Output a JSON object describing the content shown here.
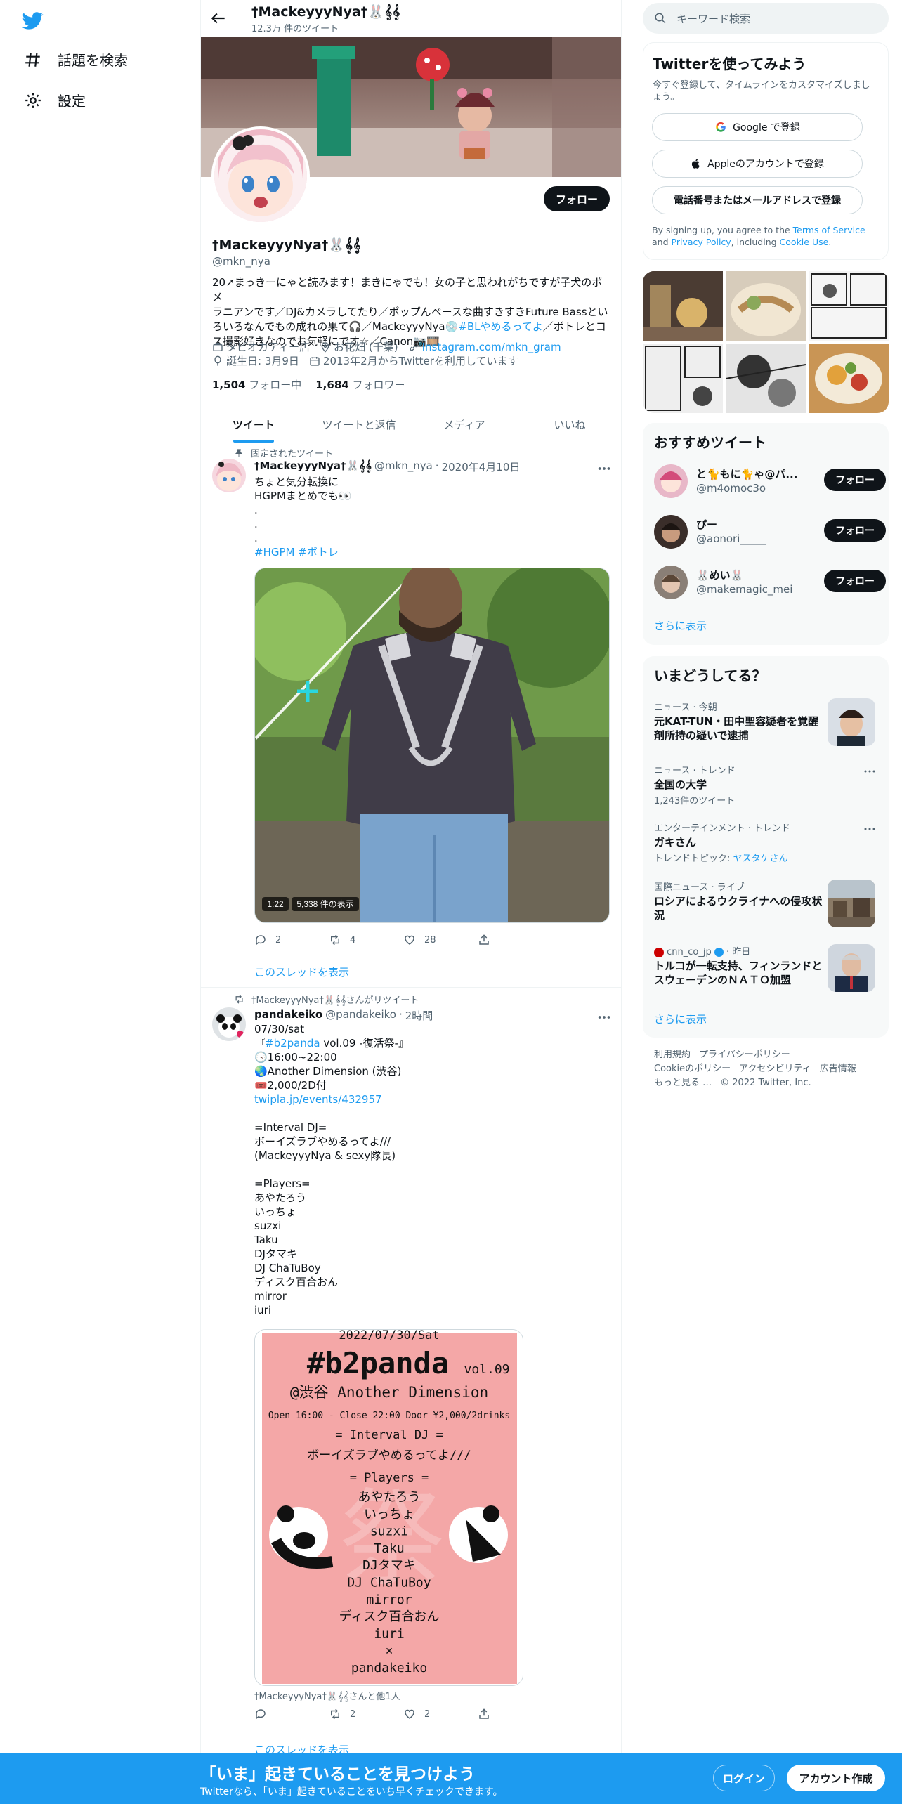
{
  "nav": {
    "items": [
      {
        "label": "話題を検索",
        "icon": "hashtag-icon"
      },
      {
        "label": "設定",
        "icon": "gear-icon"
      }
    ]
  },
  "header": {
    "name": "†MackeyyyNya†🐰𝄞𝄞",
    "tweet_count": "12.3万 件のツイート"
  },
  "profile": {
    "name": "†MackeyyyNya†🐰𝄞𝄞",
    "handle": "@mkn_nya",
    "follow_label": "フォロー",
    "bio_line1": "20↗まっきーにゃと読みます！まきにゃでも！女の子と思われがちですが子犬のポメ",
    "bio_line2": "ラニアンです／DJ&カメラしてたり／ポップんベースな曲すきすきFuture Bassとい",
    "bio_line3_a": "ろいろなんでもの成れの果て🎧／MackeyyyNya💿",
    "bio_hashtag": "#BLやめるってよ",
    "bio_line3_b": "／ボトレとコ",
    "bio_line4": "ス撮影好きなのでお気軽にです☆／Canon📷🎞️",
    "category": "タピオカティー店",
    "location": "お花畑 (千葉)",
    "link": "Instagram.com/mkn_gram",
    "birthday": "誕生日: 3月9日",
    "joined": "2013年2月からTwitterを利用しています",
    "following_count": "1,504",
    "following_label": "フォロー中",
    "followers_count": "1,684",
    "followers_label": "フォロワー"
  },
  "tabs": [
    {
      "label": "ツイート",
      "active": true
    },
    {
      "label": "ツイートと返信",
      "active": false
    },
    {
      "label": "メディア",
      "active": false
    },
    {
      "label": "いいね",
      "active": false
    }
  ],
  "tweet1": {
    "context": "固定されたツイート",
    "name": "†MackeyyyNya†🐰𝄞𝄞",
    "handle": "@mkn_nya",
    "sep": "·",
    "date": "2020年4月10日",
    "text": "ちょと気分転換に\nHGPMまとめでも👀\n.\n.\n.",
    "hashtags": "#HGPM #ボトレ",
    "video_duration": "1:22",
    "video_views": "5,338 件の表示",
    "replies": "2",
    "retweets": "4",
    "likes": "28",
    "thread_link": "このスレッドを表示"
  },
  "tweet2": {
    "context": "†MackeyyyNya†🐰𝄞𝄞さんがリツイート",
    "name": "pandakeiko",
    "handle": "@pandakeiko",
    "sep": "·",
    "date": "2時間",
    "line1": "07/30/sat",
    "line2_a": "『",
    "line2_tag": "#b2panda",
    "line2_b": " vol.09 -復活祭-』",
    "line3": "🕓16:00~22:00",
    "line4": "🌏Another Dimension (渋谷)",
    "line5": "🎟️2,000/2D付",
    "link": "twipla.jp/events/432957",
    "rest": "\n=Interval DJ=\nボーイズラブやめるってよ///\n(MackeyyyNya & sexy隊長)\n\n=Players=\nあやたろう\nいっちょ\nsuzxi\nTaku\nDJタマキ\nDJ ChaTuBoy\nディスク百合おん\nmirror\niuri",
    "flyer": {
      "date": "2022/07/30/Sat",
      "title": "#b2panda",
      "vol": "vol.09",
      "venue": "@渋谷 Another Dimension",
      "times": "Open 16:00 - Close 22:00  Door ¥2,000/2drinks",
      "interval_head": "= Interval DJ =",
      "interval_dj": "ボーイズラブやめるってよ///",
      "players_head": "= Players =",
      "players": [
        "あやたろう",
        "いっちょ",
        "suzxi",
        "Taku",
        "DJタマキ",
        "DJ ChaTuBoy",
        "mirror",
        "ディスク百合おん",
        "iuri",
        "×",
        "pandakeiko"
      ]
    },
    "tagged": "†MackeyyyNya†🐰𝄞𝄞さんと他1人",
    "replies": "",
    "retweets": "2",
    "likes": "2",
    "thread_link": "このスレッドを表示"
  },
  "right": {
    "search_placeholder": "キーワード検索",
    "signup": {
      "title": "Twitterを使ってみよう",
      "subtitle": "今すぐ登録して、タイムラインをカスタマイズしましょう。",
      "google": "Google で登録",
      "apple": "Appleのアカウントで登録",
      "phone": "電話番号またはメールアドレスで登録",
      "terms_a": "By signing up, you agree to the ",
      "terms_tos": "Terms of Service",
      "terms_b": " and ",
      "terms_pp": "Privacy Policy",
      "terms_c": ", including ",
      "terms_cookie": "Cookie Use",
      "terms_d": "."
    },
    "recommend": {
      "title": "おすすめツイート",
      "users": [
        {
          "name": "と🐈もに🐈ゃ@パ...",
          "handle": "@m4omoc3o",
          "button": "フォロー"
        },
        {
          "name": "ぴー",
          "handle": "@aonori_____",
          "button": "フォロー"
        },
        {
          "name": "🐰めい🐰",
          "handle": "@makemagic_mei",
          "button": "フォロー"
        }
      ],
      "more": "さらに表示"
    },
    "trends": {
      "title": "いまどうしてる？",
      "items": [
        {
          "meta": "ニュース · 今朝",
          "title": "元KAT-TUN・田中聖容疑者を覚醒剤所持の疑いで逮捕",
          "sub": ""
        },
        {
          "meta": "ニュース · トレンド",
          "title": "全国の大学",
          "sub": "1,243件のツイート"
        },
        {
          "meta": "エンターテインメント · トレンド",
          "title": "ガキさん",
          "sub_a": "トレンドトピック: ",
          "sub_b": "ヤスタケさん"
        },
        {
          "meta": "国際ニュース · ライブ",
          "title": "ロシアによるウクライナへの侵攻状況",
          "sub": ""
        },
        {
          "meta_src": "cnn_co_jp",
          "meta_time": " · 昨日",
          "title": "トルコが一転支持、フィンランドとスウェーデンのＮＡＴＯ加盟",
          "sub": ""
        }
      ],
      "more": "さらに表示"
    },
    "footer": [
      "利用規約",
      "プライバシーポリシー",
      "Cookieのポリシー",
      "アクセシビリティ",
      "広告情報",
      "もっと見る …",
      "© 2022 Twitter, Inc."
    ]
  },
  "bottombar": {
    "title": "「いま」起きていることを見つけよう",
    "subtitle": "Twitterなら、「いま」起きていることをいち早くチェックできます。",
    "login": "ログイン",
    "signup": "アカウント作成"
  },
  "colors": {
    "accent": "#1d9bf0",
    "text": "#0f1419",
    "muted": "#536471",
    "flyer_pink": "#f4a7a7"
  }
}
